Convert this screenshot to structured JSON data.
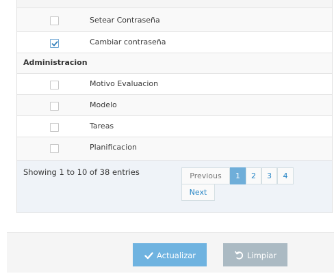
{
  "permissions_table": {
    "rows_before": [
      {
        "label": "Setear Contraseña",
        "checked": false
      },
      {
        "label": "Cambiar contraseña",
        "checked": true
      }
    ],
    "group": "Administracion",
    "rows_after": [
      {
        "label": "Motivo Evaluacion",
        "checked": false
      },
      {
        "label": "Modelo",
        "checked": false
      },
      {
        "label": "Tareas",
        "checked": false
      },
      {
        "label": "Planificacion",
        "checked": false
      }
    ]
  },
  "footer": {
    "info": "Showing 1 to 10 of 38 entries",
    "pagination": {
      "previous": "Previous",
      "pages": [
        "1",
        "2",
        "3",
        "4"
      ],
      "active": "1",
      "next": "Next"
    }
  },
  "actions": {
    "update_label": "Actualizar",
    "update_icon": "check-icon",
    "clear_label": "Limpiar",
    "clear_icon": "undo-icon"
  },
  "colors": {
    "primary": "#6fb3e0",
    "secondary": "#abbac3",
    "pager_active": "#6faed9",
    "link": "#2283c5"
  }
}
